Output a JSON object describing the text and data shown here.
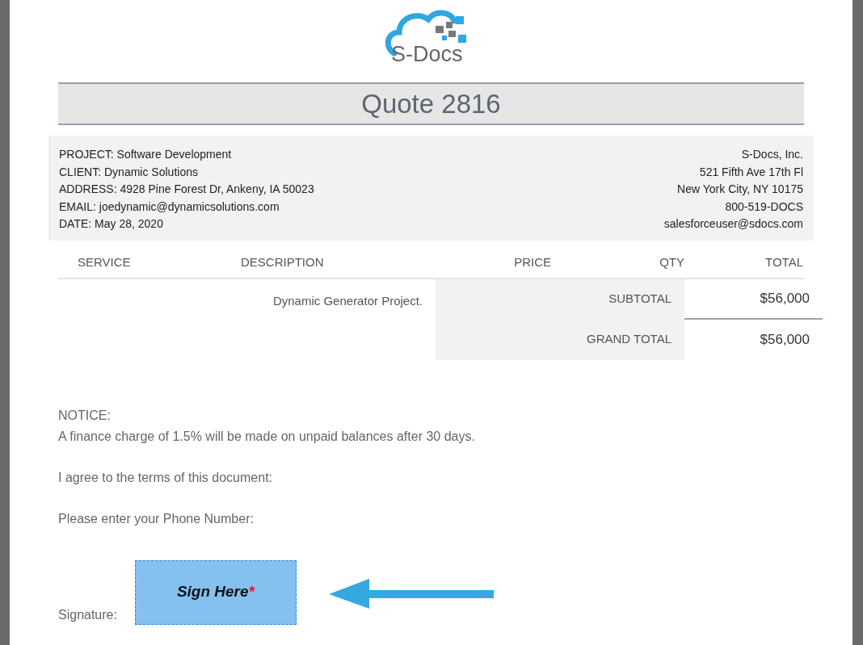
{
  "logo": {
    "text": "S-Docs"
  },
  "title": "Quote 2816",
  "client_info": [
    "PROJECT: Software Development",
    "CLIENT: Dynamic Solutions",
    "ADDRESS: 4928 Pine Forest Dr, Ankeny, IA 50023",
    "EMAIL: joedynamic@dynamicsolutions.com",
    "DATE: May 28, 2020"
  ],
  "company_info": [
    "S-Docs, Inc.",
    "521 Fifth Ave 17th Fl",
    "New York City, NY 10175",
    "800-519-DOCS",
    "salesforceuser@sdocs.com"
  ],
  "table": {
    "columns": [
      "SERVICE",
      "DESCRIPTION",
      "PRICE",
      "QTY",
      "TOTAL"
    ],
    "rows": [
      {
        "description": "Dynamic Generator Project."
      }
    ],
    "totals": [
      {
        "label": "SUBTOTAL",
        "value": "$56,000"
      },
      {
        "label": "GRAND TOTAL",
        "value": "$56,000"
      }
    ]
  },
  "notice": {
    "heading": "NOTICE:",
    "text": "A finance charge of 1.5% will be made on unpaid balances after 30 days."
  },
  "prompts": [
    "I agree to the terms of this document:",
    "Please enter your Phone Number:"
  ],
  "signature": {
    "label": "Signature:",
    "button": "Sign Here",
    "required_mark": "*"
  }
}
